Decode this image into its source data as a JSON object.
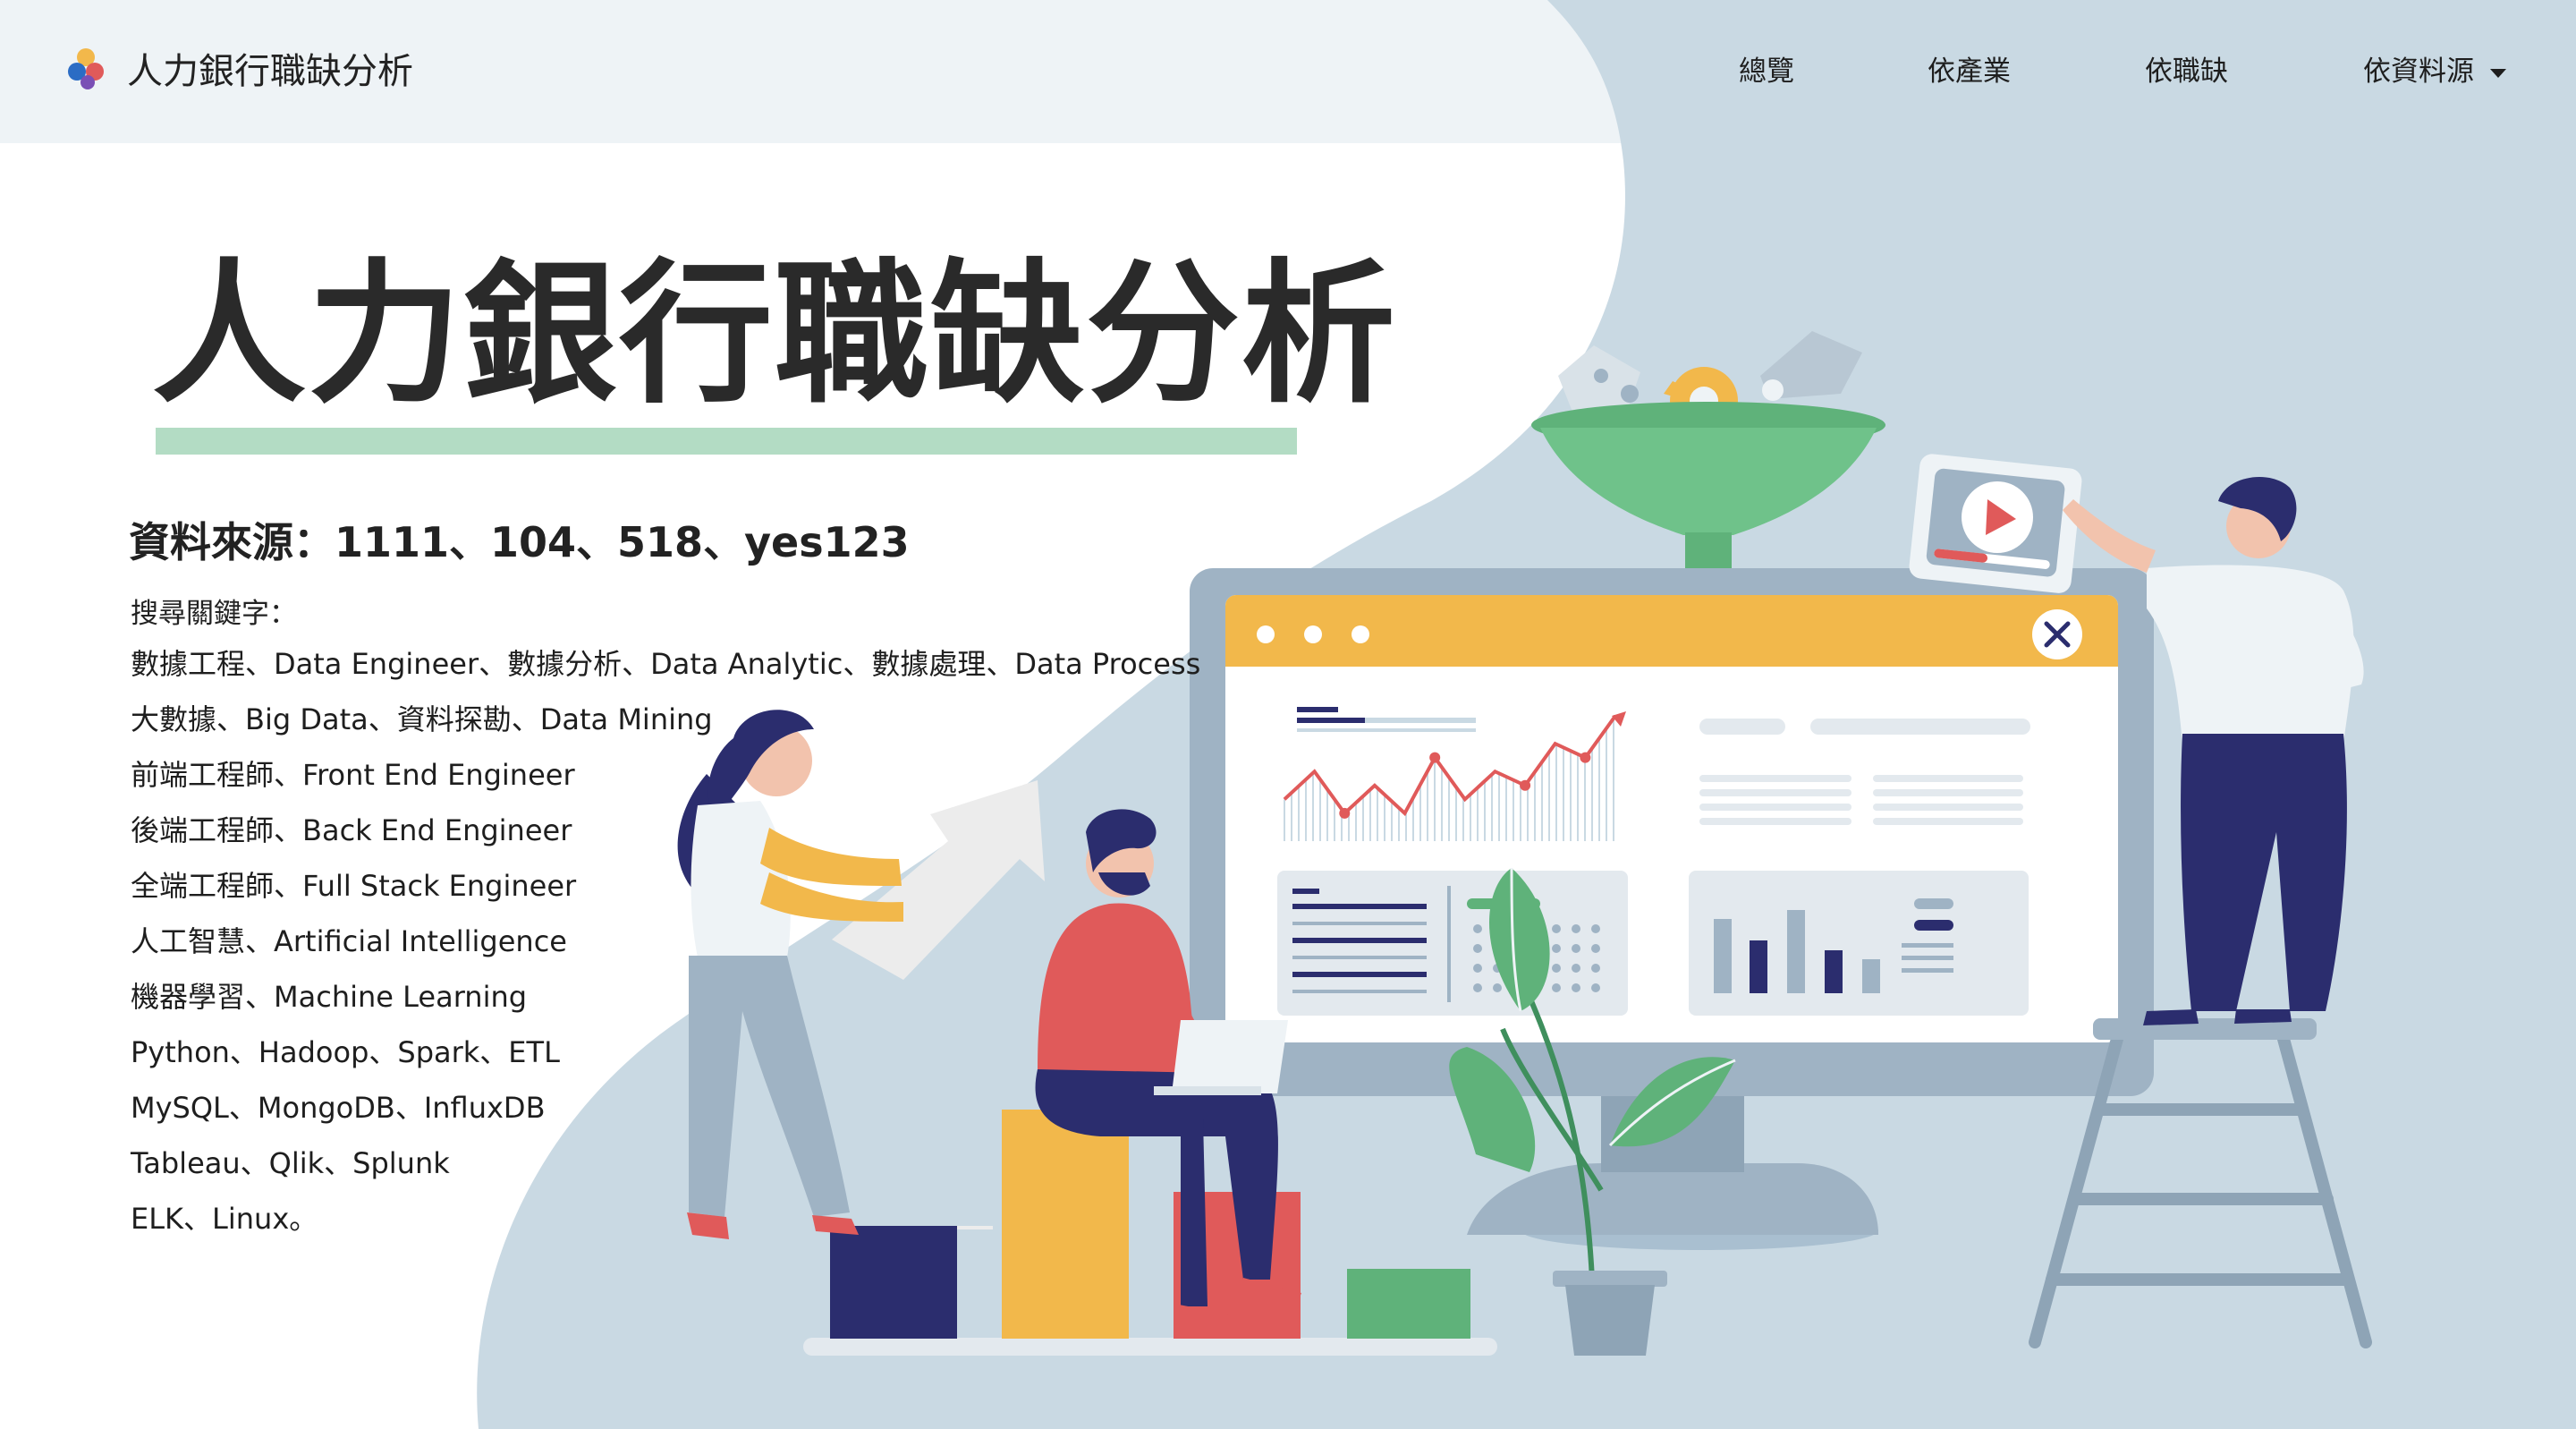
{
  "brand": {
    "name": "人力銀行職缺分析"
  },
  "nav": {
    "items": [
      {
        "label": "總覽"
      },
      {
        "label": "依產業"
      },
      {
        "label": "依職缺"
      },
      {
        "label": "依資料源"
      }
    ]
  },
  "hero": {
    "title": "人力銀行職缺分析",
    "source_line": "資料來源：1111、104、518、yes123",
    "keywords_label": "搜尋關鍵字：",
    "keywords": [
      "數據工程、Data Engineer、數據分析、Data Analytic、數據處理、Data Process",
      "大數據、Big Data、資料探勘、Data Mining",
      "前端工程師、Front End Engineer",
      "後端工程師、Back End Engineer",
      "全端工程師、Full Stack Engineer",
      "人工智慧、Artificial Intelligence",
      "機器學習、Machine Learning",
      "Python、Hadoop、Spark、ETL",
      "MySQL、MongoDB、InfluxDB",
      "Tableau、Qlik、Splunk",
      "ELK、Linux。"
    ]
  },
  "colors": {
    "bg_blue": "#c9d9e3",
    "topbar": "#eef3f6",
    "accent_green": "#b3dcc4",
    "funnel_green": "#5fb27a",
    "panel_yellow": "#f2b84b",
    "navy": "#2b2d6e",
    "red": "#e05a5a",
    "screen_grey": "#9fb3c4"
  },
  "chart_data": {
    "type": "line",
    "values": [
      3,
      5,
      2,
      4,
      2,
      6,
      3,
      5,
      4,
      7,
      6,
      9
    ]
  }
}
